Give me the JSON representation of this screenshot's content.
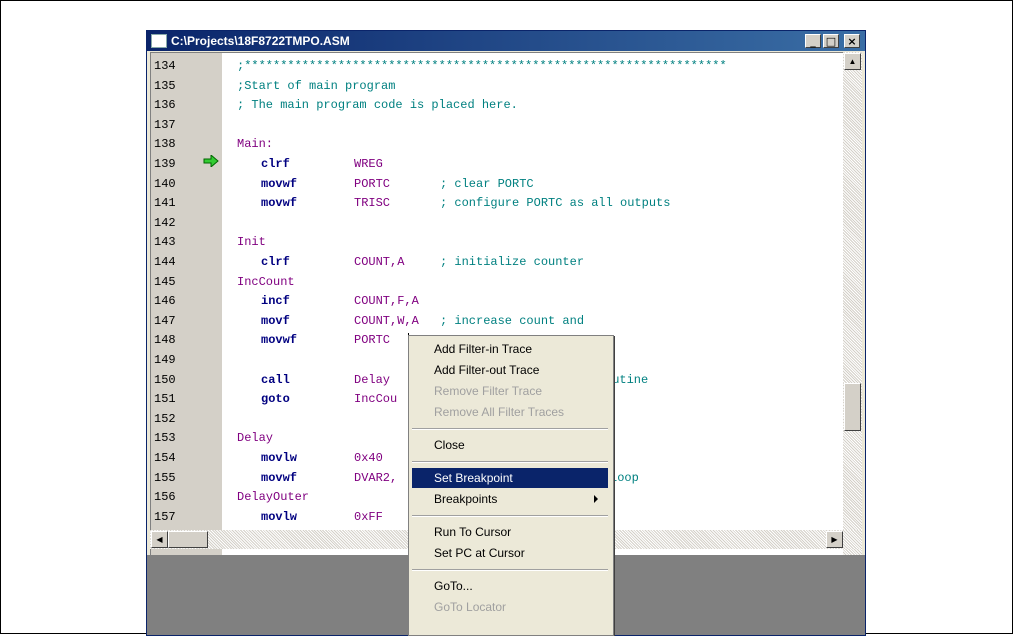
{
  "window": {
    "title": "C:\\Projects\\18F8722TMPO.ASM",
    "minimize_glyph": "_",
    "restore_glyph": "□",
    "close_glyph": "×"
  },
  "editor": {
    "lines": [
      {
        "num": "134",
        "text": ";*******************************************************************",
        "kind": "comment"
      },
      {
        "num": "135",
        "text": ";Start of main program",
        "kind": "comment"
      },
      {
        "num": "136",
        "text": "; The main program code is placed here.",
        "kind": "comment"
      },
      {
        "num": "137",
        "text": "",
        "kind": "blank"
      },
      {
        "num": "138",
        "text": "Main:",
        "kind": "label"
      },
      {
        "num": "139",
        "instr": "clrf",
        "operand": "WREG",
        "comment": "",
        "kind": "instr"
      },
      {
        "num": "140",
        "instr": "movwf",
        "operand": "PORTC",
        "comment": "; clear PORTC",
        "kind": "instr"
      },
      {
        "num": "141",
        "instr": "movwf",
        "operand": "TRISC",
        "comment": "; configure PORTC as all outputs",
        "kind": "instr"
      },
      {
        "num": "142",
        "text": "",
        "kind": "blank"
      },
      {
        "num": "143",
        "text": "Init",
        "kind": "label"
      },
      {
        "num": "144",
        "instr": "clrf",
        "operand": "COUNT,A",
        "comment": "; initialize counter",
        "kind": "instr"
      },
      {
        "num": "145",
        "text": "IncCount",
        "kind": "label"
      },
      {
        "num": "146",
        "instr": "incf",
        "operand": "COUNT,F,A",
        "comment": "",
        "kind": "instr"
      },
      {
        "num": "147",
        "instr": "movf",
        "operand": "COUNT,W,A",
        "comment": "; increase count and",
        "kind": "instr"
      },
      {
        "num": "148",
        "instr": "movwf",
        "operand": "PORTC",
        "comment": "",
        "kind": "instr"
      },
      {
        "num": "149",
        "text": "",
        "kind": "blank"
      },
      {
        "num": "150",
        "instr": "call",
        "operand": "Delay",
        "comment": "outine",
        "kind": "instr"
      },
      {
        "num": "151",
        "instr": "goto",
        "operand": "IncCou",
        "comment": "",
        "kind": "instr"
      },
      {
        "num": "152",
        "text": "",
        "kind": "blank"
      },
      {
        "num": "153",
        "text": "Delay",
        "kind": "label"
      },
      {
        "num": "154",
        "instr": "movlw",
        "operand": "0x40",
        "comment": "",
        "kind": "instr"
      },
      {
        "num": "155",
        "instr": "movwf",
        "operand": "DVAR2,",
        "comment": "loop",
        "kind": "instr"
      },
      {
        "num": "156",
        "text": "DelayOuter",
        "kind": "label"
      },
      {
        "num": "157",
        "instr": "movlw",
        "operand": "0xFF",
        "comment": "",
        "kind": "instr"
      }
    ],
    "current_line": "139"
  },
  "context_menu": {
    "items": [
      {
        "label": "Add Filter-in Trace",
        "enabled": true
      },
      {
        "label": "Add Filter-out Trace",
        "enabled": true
      },
      {
        "label": "Remove Filter Trace",
        "enabled": false
      },
      {
        "label": "Remove All Filter Traces",
        "enabled": false
      },
      {
        "separator": true
      },
      {
        "label": "Close",
        "enabled": true
      },
      {
        "separator": true
      },
      {
        "label": "Set Breakpoint",
        "enabled": true,
        "selected": true
      },
      {
        "label": "Breakpoints",
        "enabled": true,
        "submenu": true
      },
      {
        "separator": true
      },
      {
        "label": "Run To Cursor",
        "enabled": true
      },
      {
        "label": "Set PC at Cursor",
        "enabled": true
      },
      {
        "separator": true
      },
      {
        "label": "GoTo...",
        "enabled": true
      },
      {
        "label": "GoTo Locator",
        "enabled": false
      }
    ]
  },
  "colors": {
    "titlebar": "#0a246a",
    "comment": "#008080",
    "label": "#800080",
    "instruction": "#000080",
    "pc_arrow": "#33cc33",
    "menu_highlight": "#0a246a"
  }
}
